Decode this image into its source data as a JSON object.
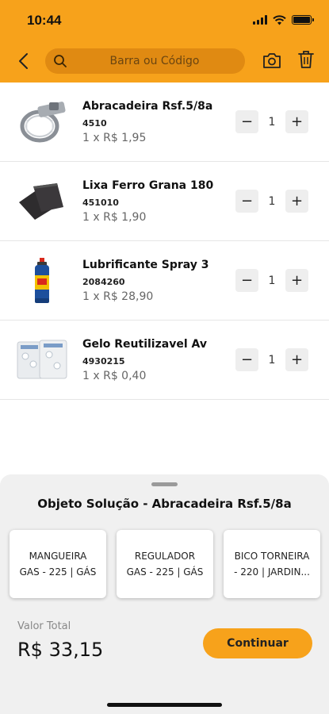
{
  "status_bar": {
    "time": "10:44"
  },
  "header": {
    "search_placeholder": "Barra ou Código",
    "icons": [
      "back-icon",
      "search-icon",
      "camera-icon",
      "trash-icon"
    ],
    "accent_color": "#f7a21b"
  },
  "items": [
    {
      "name": "Abracadeira Rsf.5/8a",
      "code": "4510",
      "price": "1 x R$ 1,95",
      "qty": "1",
      "image": "hose-clamp"
    },
    {
      "name": "Lixa Ferro Grana 180",
      "code": "451010",
      "price": "1 x R$ 1,90",
      "qty": "1",
      "image": "sandpaper"
    },
    {
      "name": "Lubrificante Spray 3",
      "code": "2084260",
      "price": "1 x R$ 28,90",
      "qty": "1",
      "image": "spray-can"
    },
    {
      "name": "Gelo Reutilizavel Av",
      "code": "4930215",
      "price": "1 x R$ 0,40",
      "qty": "1",
      "image": "ice-packs"
    }
  ],
  "stepper": {
    "minus": "−",
    "plus": "+"
  },
  "sheet": {
    "title": "Objeto Solução - Abracadeira Rsf.5/8a",
    "suggestions": [
      {
        "line1": "MANGUEIRA",
        "line2": "GAS - 225 | GÁS"
      },
      {
        "line1": "REGULADOR",
        "line2": "GAS - 225 | GÁS"
      },
      {
        "line1": "BICO TORNEIRA",
        "line2": "- 220 | JARDIN..."
      }
    ],
    "total_label": "Valor Total",
    "total_value": "R$ 33,15",
    "continue_label": "Continuar"
  }
}
